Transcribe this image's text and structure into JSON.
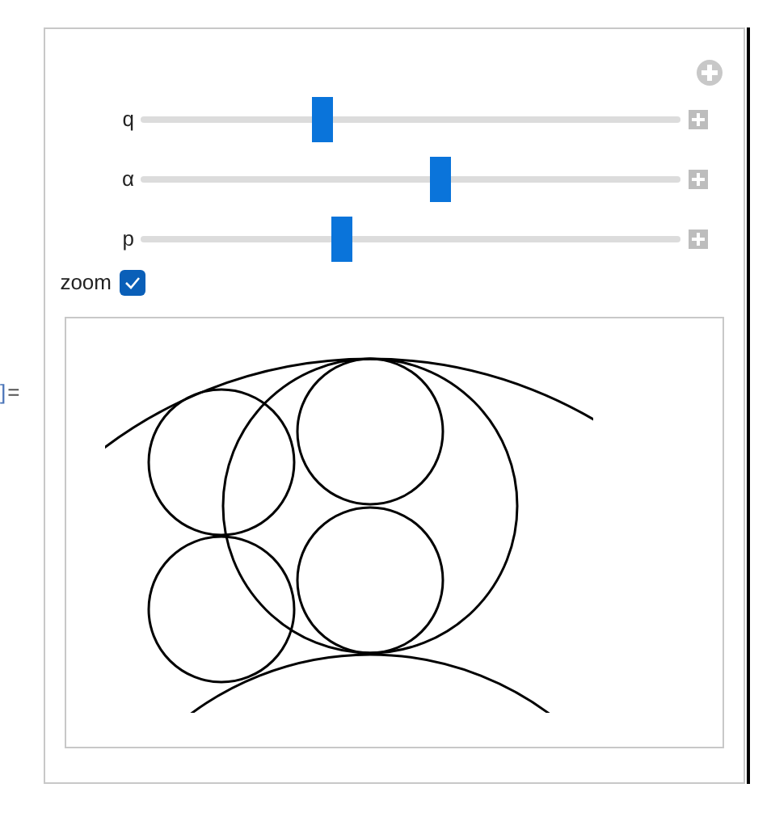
{
  "cell_label": {
    "bracket": "]",
    "equals": "="
  },
  "sliders": [
    {
      "label": "q",
      "level": 0.335
    },
    {
      "label": "α",
      "level": 0.554
    },
    {
      "label": "p",
      "level": 0.371
    }
  ],
  "zoom": {
    "label": "zoom",
    "checked": true
  }
}
